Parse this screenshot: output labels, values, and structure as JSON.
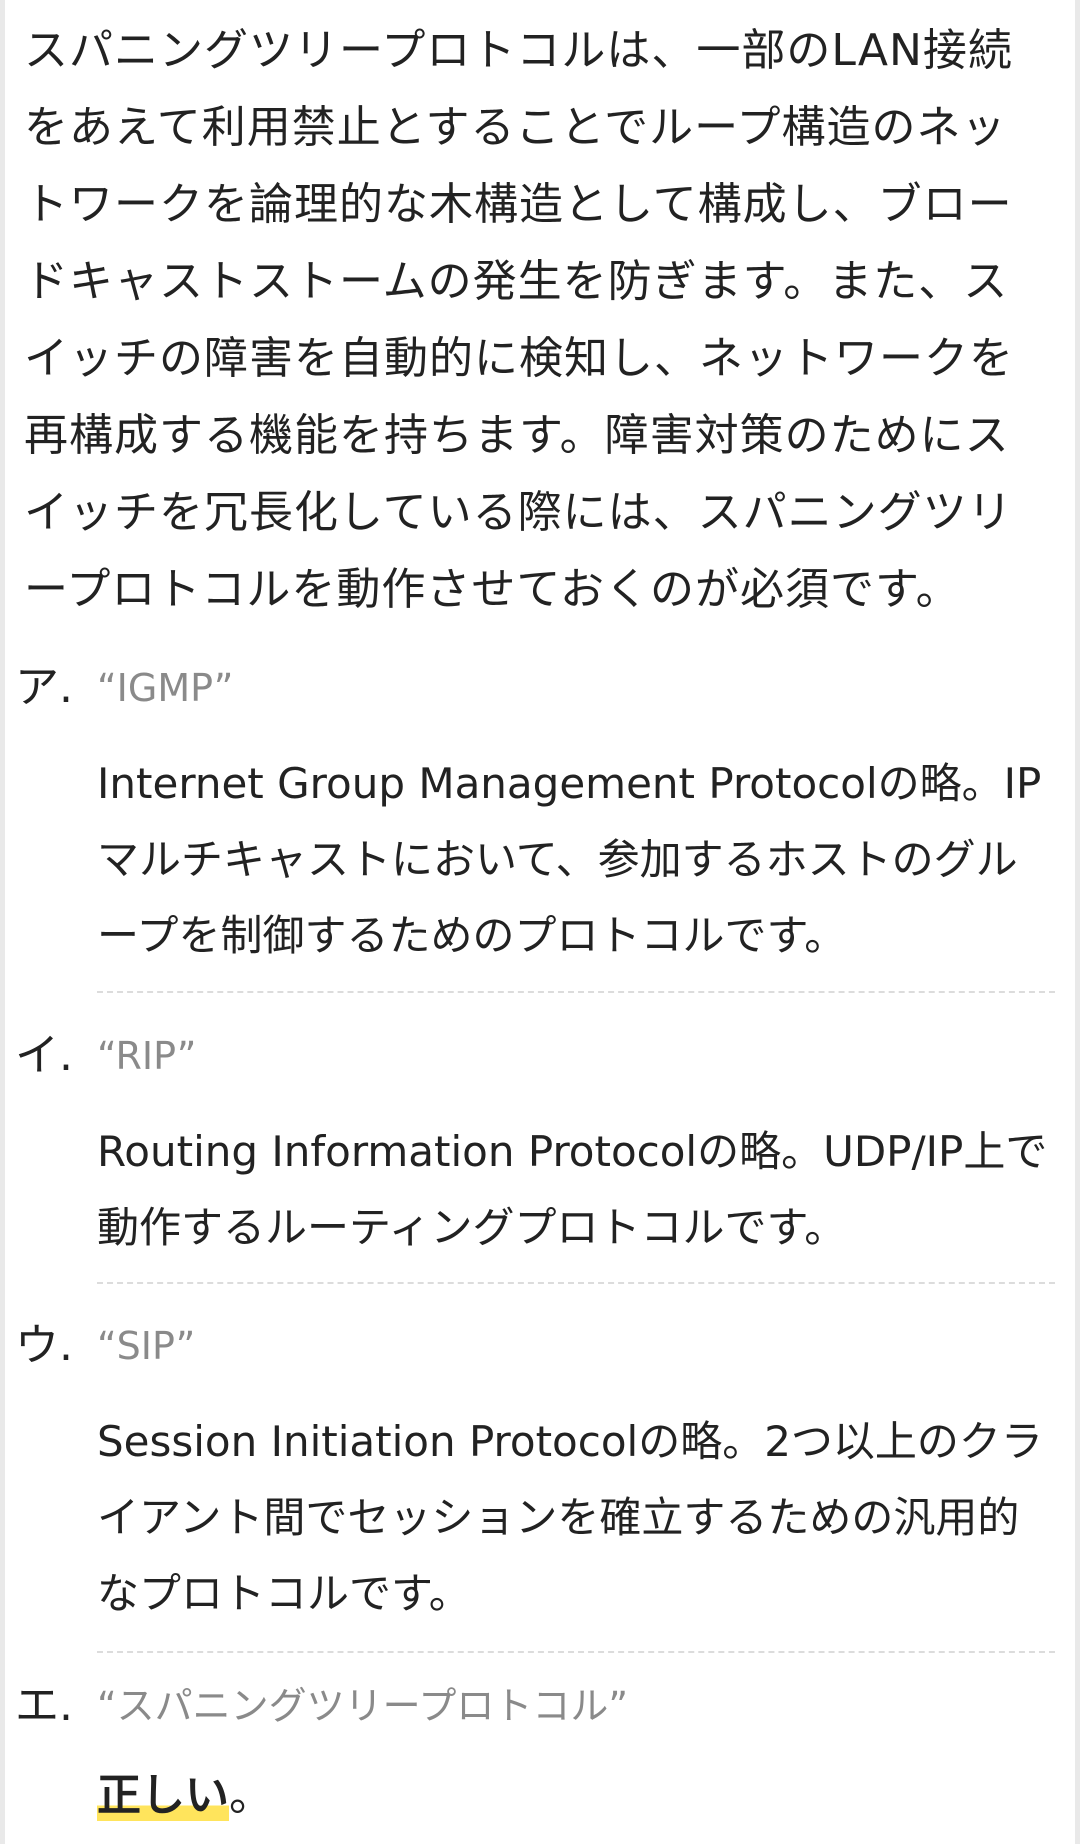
{
  "intro": "スパニングツリープロトコルは、一部のLAN接続をあえて利用禁止とすることでループ構造のネットワークを論理的な木構造として構成し、ブロードキャストストームの発生を防ぎます。また、スイッチの障害を自動的に検知し、ネットワークを再構成する機能を持ちます。障害対策のためにスイッチを冗長化している際には、スパニングツリープロトコルを動作させておくのが必須です。",
  "choices": [
    {
      "label": "ア.",
      "title": "“IGMP”",
      "description": "Internet Group Management Protocolの略。IPマルチキャストにおいて、参加するホストのグループを制御するためのプロトコルです。"
    },
    {
      "label": "イ.",
      "title": "“RIP”",
      "description": "Routing Information Protocolの略。UDP/IP上で動作するルーティングプロトコルです。"
    },
    {
      "label": "ウ.",
      "title": "“SIP”",
      "description": "Session Initiation Protocolの略。2つ以上のクライアント間でセッションを確立するための汎用的なプロトコルです。"
    },
    {
      "label": "エ.",
      "title": "“スパニングツリープロトコル”",
      "verdict": "正しい",
      "verdict_suffix": "。"
    }
  ],
  "colors": {
    "text": "#222222",
    "muted": "#8a8a8a",
    "highlight": "#ffe45c",
    "divider": "#dcdcdc"
  }
}
